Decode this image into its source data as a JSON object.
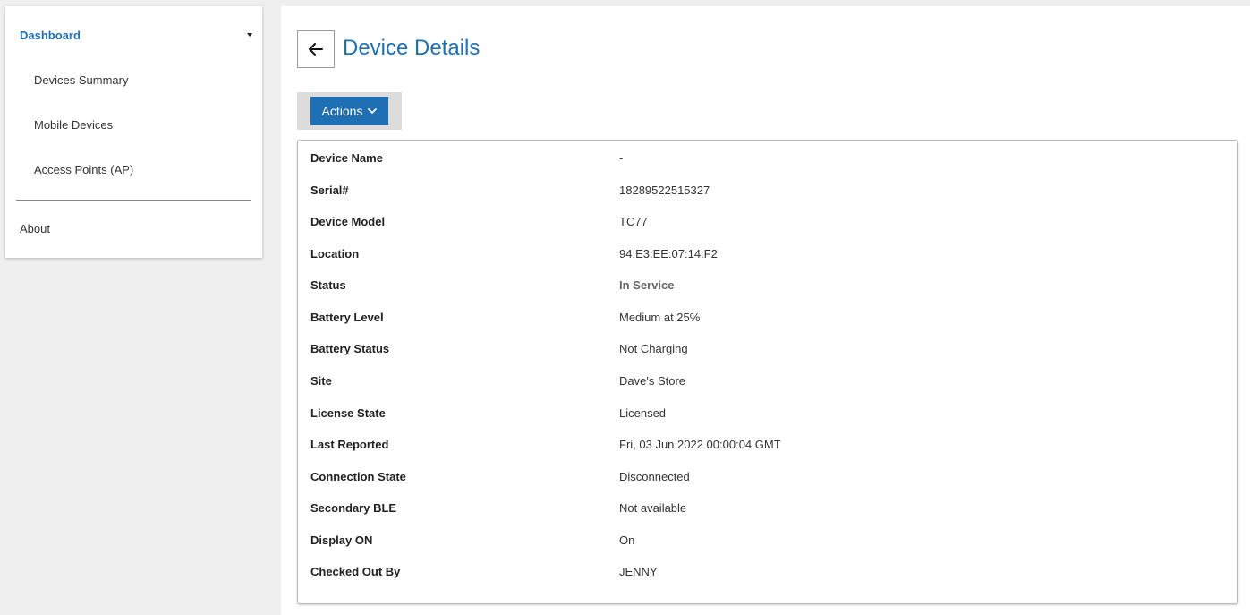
{
  "sidebar": {
    "dashboard_label": "Dashboard",
    "items": [
      {
        "label": "Devices Summary"
      },
      {
        "label": "Mobile Devices"
      },
      {
        "label": "Access Points (AP)"
      }
    ],
    "about_label": "About"
  },
  "header": {
    "title": "Device Details",
    "actions_label": "Actions"
  },
  "details": [
    {
      "label": "Device Name",
      "value": "-"
    },
    {
      "label": "Serial#",
      "value": "18289522515327"
    },
    {
      "label": "Device Model",
      "value": "TC77"
    },
    {
      "label": "Location",
      "value": "94:E3:EE:07:14:F2"
    },
    {
      "label": "Status",
      "value": "In Service"
    },
    {
      "label": "Battery Level",
      "value": "Medium at 25%"
    },
    {
      "label": "Battery Status",
      "value": "Not Charging"
    },
    {
      "label": "Site",
      "value": "Dave's Store"
    },
    {
      "label": "License State",
      "value": "Licensed"
    },
    {
      "label": "Last Reported",
      "value": "Fri, 03 Jun 2022 00:00:04 GMT"
    },
    {
      "label": "Connection State",
      "value": "Disconnected"
    },
    {
      "label": "Secondary BLE",
      "value": "Not available"
    },
    {
      "label": "Display ON",
      "value": "On"
    },
    {
      "label": "Checked Out By",
      "value": "JENNY"
    }
  ],
  "colors": {
    "accent": "#1f6fb5",
    "background": "#efefef",
    "status_text": "#666666"
  },
  "icons": {
    "back": "arrow-left-icon",
    "actions_caret": "chevron-down-icon",
    "dashboard_caret": "caret-down-icon"
  }
}
